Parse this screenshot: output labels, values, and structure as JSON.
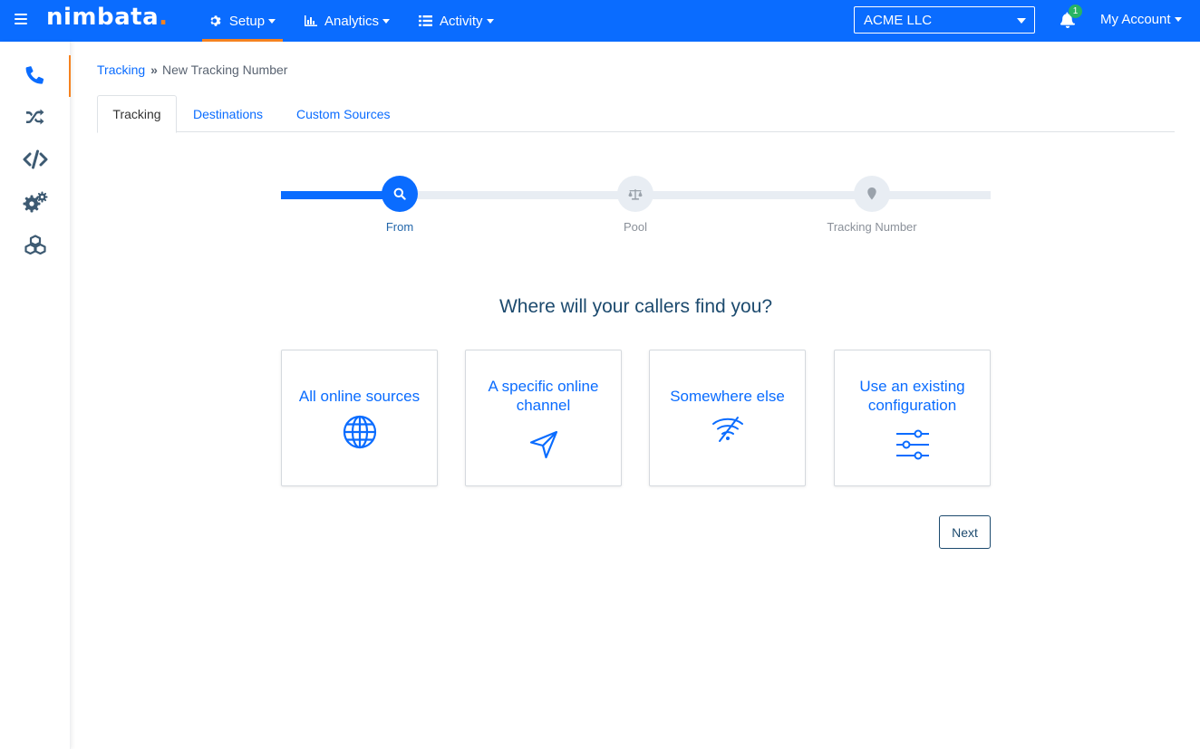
{
  "app": {
    "logo_text": "nimbata",
    "logo_dot": ".",
    "accent_color": "#0a6cff",
    "highlight_color": "#f5821f"
  },
  "navbar": {
    "menu_icon": "hamburger-icon",
    "items": [
      {
        "label": "Setup",
        "icon": "gear-icon",
        "active": true
      },
      {
        "label": "Analytics",
        "icon": "bar-chart-icon"
      },
      {
        "label": "Activity",
        "icon": "list-icon"
      }
    ],
    "company": "ACME LLC",
    "notifications_count": "1",
    "account_label": "My Account"
  },
  "sidebar": {
    "items": [
      {
        "icon": "phone-icon",
        "active": true
      },
      {
        "icon": "shuffle-icon"
      },
      {
        "icon": "code-icon"
      },
      {
        "icon": "gears-icon"
      },
      {
        "icon": "cubes-icon"
      }
    ]
  },
  "breadcrumb": {
    "parent": "Tracking",
    "separator": "»",
    "current": "New Tracking Number"
  },
  "tabs": [
    {
      "label": "Tracking",
      "active": true
    },
    {
      "label": "Destinations"
    },
    {
      "label": "Custom Sources"
    }
  ],
  "stepper": {
    "steps": [
      {
        "label": "From",
        "icon": "search-icon",
        "active": true
      },
      {
        "label": "Pool",
        "icon": "balance-scale-icon"
      },
      {
        "label": "Tracking Number",
        "icon": "map-pin-icon"
      }
    ]
  },
  "question": "Where will your callers find you?",
  "options": [
    {
      "label": "All online sources",
      "icon": "globe-icon"
    },
    {
      "label": "A specific online channel",
      "icon": "paper-plane-icon"
    },
    {
      "label": "Somewhere else",
      "icon": "wifi-off-icon"
    },
    {
      "label": "Use an existing configuration",
      "icon": "sliders-icon"
    }
  ],
  "next_label": "Next"
}
